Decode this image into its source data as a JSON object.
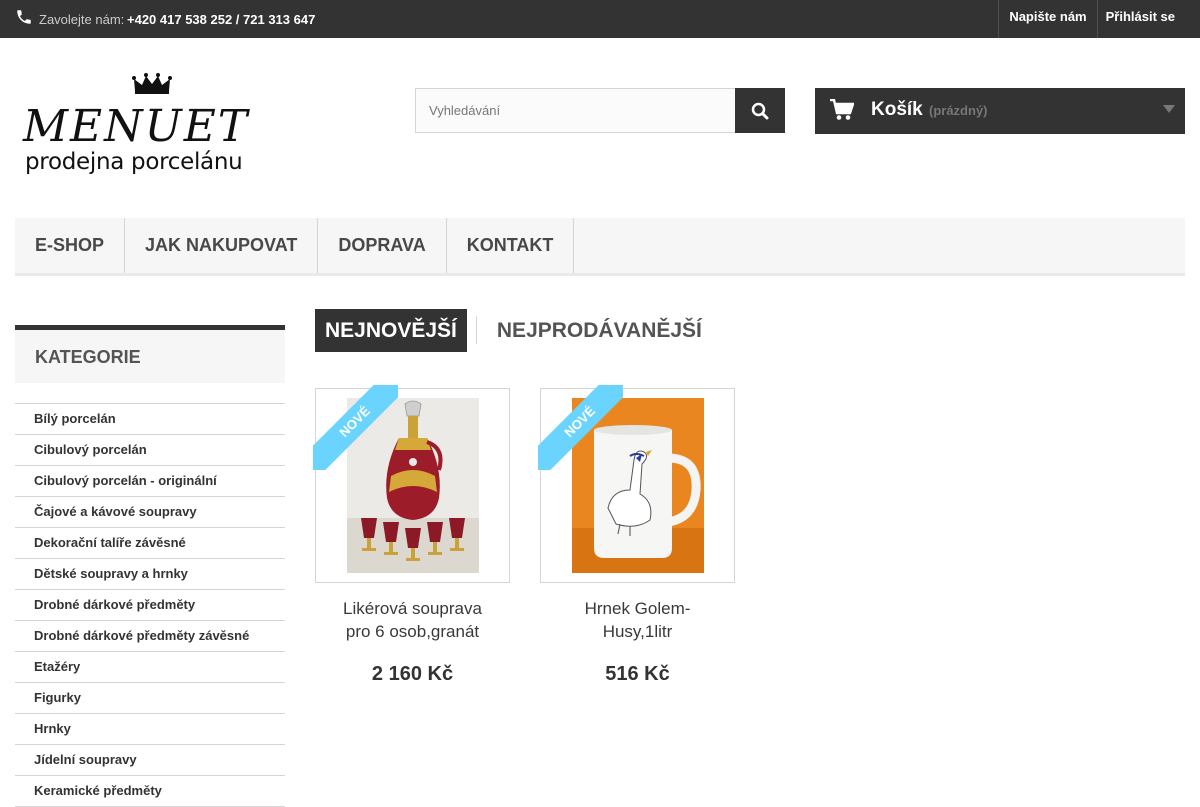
{
  "topbar": {
    "contact_label": "Zavolejte nám:",
    "contact_number": "+420 417 538 252 / 721 313 647",
    "link_contact": "Napište nám",
    "link_login": "Přihlásit se"
  },
  "logo": {
    "name": "MENUET",
    "subtitle": "prodejna porcelánu"
  },
  "search": {
    "placeholder": "Vyhledávání"
  },
  "cart": {
    "title": "Košík",
    "status": "(prázdný)"
  },
  "nav": {
    "items": [
      {
        "label": "E-SHOP"
      },
      {
        "label": "JAK NAKUPOVAT"
      },
      {
        "label": "DOPRAVA"
      },
      {
        "label": "KONTAKT"
      }
    ]
  },
  "sidebar": {
    "title": "KATEGORIE",
    "categories": [
      "Bílý porcelán",
      "Cibulový porcelán",
      "Cibulový porcelán - originální",
      "Čajové a kávové soupravy",
      "Dekorační talíře závěsné",
      "Dětské soupravy a hrnky",
      "Drobné dárkové předměty",
      "Drobné dárkové předměty závěsné",
      "Etažéry",
      "Figurky",
      "Hrnky",
      "Jídelní soupravy",
      "Keramické předměty"
    ]
  },
  "tabs": {
    "active": "NEJNOVĚJŠÍ",
    "inactive": "NEJPRODÁVANĚJŠÍ"
  },
  "products": [
    {
      "name": "Likérová souprava pro 6 osob,granát",
      "price": "2 160 Kč",
      "badge": "NOVÉ"
    },
    {
      "name": "Hrnek Golem-Husy,1litr",
      "price": "516 Kč",
      "badge": "NOVÉ"
    }
  ],
  "colors": {
    "dark": "#333333",
    "badge": "#6ad4ff"
  }
}
